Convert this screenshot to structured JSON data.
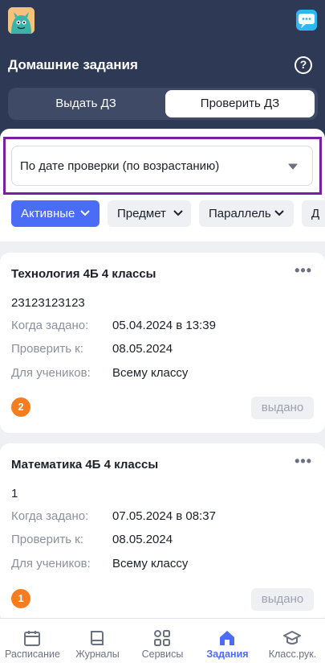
{
  "header": {
    "title": "Домашние задания",
    "help_label": "?",
    "tabs": [
      {
        "label": "Выдать ДЗ",
        "active": false
      },
      {
        "label": "Проверить ДЗ",
        "active": true
      }
    ]
  },
  "sort": {
    "value": "По дате проверки (по возрастанию)"
  },
  "filters": [
    {
      "label": "Активные",
      "active": true
    },
    {
      "label": "Предмет",
      "active": false
    },
    {
      "label": "Параллель",
      "active": false
    },
    {
      "label": "Д",
      "active": false
    }
  ],
  "cards": [
    {
      "title": "Технология 4Б 4 классы",
      "description": "23123123123",
      "given_label": "Когда задано:",
      "given_value": "05.04.2024 в 13:39",
      "check_label": "Проверить к:",
      "check_value": "08.05.2024",
      "for_label": "Для учеников:",
      "for_value": "Всему классу",
      "count": "2",
      "status": "выдано"
    },
    {
      "title": "Математика 4Б 4 классы",
      "description": "1",
      "given_label": "Когда задано:",
      "given_value": "07.05.2024 в 08:37",
      "check_label": "Проверить к:",
      "check_value": "08.05.2024",
      "for_label": "Для учеников:",
      "for_value": "Всему классу",
      "count": "1",
      "status": "выдано"
    }
  ],
  "tabbar": [
    {
      "label": "Расписание",
      "icon": "calendar-icon",
      "active": false
    },
    {
      "label": "Журналы",
      "icon": "book-icon",
      "active": false
    },
    {
      "label": "Сервисы",
      "icon": "grid-icon",
      "active": false
    },
    {
      "label": "Задания",
      "icon": "home-icon",
      "active": true
    },
    {
      "label": "Класс.рук.",
      "icon": "graduation-cap-icon",
      "active": false
    }
  ],
  "colors": {
    "header_bg": "#2e3a55",
    "accent": "#4a6cf7",
    "badge": "#f57c1f",
    "highlight_outline": "#7b1fa2"
  }
}
